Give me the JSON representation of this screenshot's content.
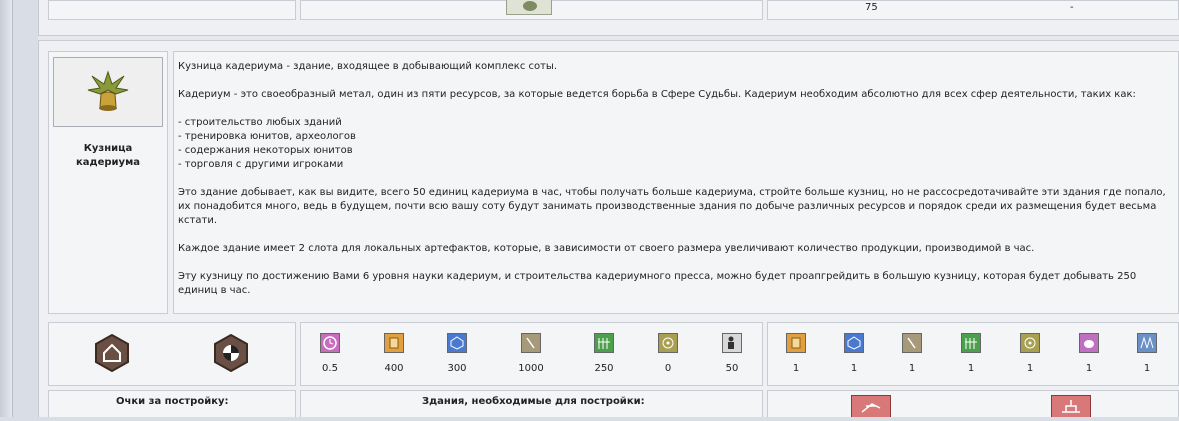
{
  "top_row": {
    "value_a": "75",
    "value_b": "-"
  },
  "building": {
    "name_line1": "Кузница",
    "name_line2": "кадериума",
    "icon": "cadherium-forge-icon"
  },
  "description": {
    "p1": "Кузница кадериума - здание, входящее в добывающий комплекс соты.",
    "p2": "Кадериум - это своеобразный метал, один из пяти ресурсов, за которые ведется борьба в Сфере Судьбы. Кадериум необходим абсолютно для всех сфер деятельности, таких как:",
    "list": [
      "- строительство любых зданий",
      "- тренировка юнитов, археологов",
      "- содержания некоторых юнитов",
      "- торговля с другими игроками"
    ],
    "p3": "Это здание добывает, как вы видите, всего 50 единиц кадериума в час, чтобы получать больше кадериума, стройте больше кузниц, но не рассосредотачивайте эти здания где попало, их понадобится много, ведь в будущем, почти всю вашу соту будут занимать производственные здания по добыче различных ресурсов и порядок среди их размещения будет весьма кстати.",
    "p4": "Каждое здание имеет 2 слота для локальных артефактов, которые, в зависимости от своего размера увеличивают количество продукции, производимой в час.",
    "p5": "Эту кузницу по достижению Вами 6 уровня науки кадериум, и строительства кадериумного пресса, можно будет проапгрейдить в большую кузницу, которая будет добывать 250 единиц в час."
  },
  "costs": [
    {
      "icon": "clock-icon",
      "value": "0.5",
      "color": "#c86cc0"
    },
    {
      "icon": "cadherium-icon",
      "value": "400",
      "color": "#e0a040"
    },
    {
      "icon": "crystal-icon",
      "value": "300",
      "color": "#4a7ad0"
    },
    {
      "icon": "pick-icon",
      "value": "1000",
      "color": "#a69a7a"
    },
    {
      "icon": "fence-icon",
      "value": "250",
      "color": "#4ca04c"
    },
    {
      "icon": "target-icon",
      "value": "0",
      "color": "#a8a050"
    },
    {
      "icon": "worker-icon",
      "value": "50",
      "color": "#d8d8d8"
    }
  ],
  "requirements": [
    {
      "icon": "cadherium-icon",
      "value": "1",
      "color": "#e0a040"
    },
    {
      "icon": "crystal-icon",
      "value": "1",
      "color": "#4a7ad0"
    },
    {
      "icon": "pick-icon",
      "value": "1",
      "color": "#a69a7a"
    },
    {
      "icon": "fence-icon",
      "value": "1",
      "color": "#4ca04c"
    },
    {
      "icon": "target-icon",
      "value": "1",
      "color": "#a8a050"
    },
    {
      "icon": "blob-icon",
      "value": "1",
      "color": "#c070c0"
    },
    {
      "icon": "book-icon",
      "value": "1",
      "color": "#6a90c8"
    }
  ],
  "labels": {
    "build_points": "Очки за постройку:",
    "required_buildings": "Здания, необходимые для постройки:"
  }
}
